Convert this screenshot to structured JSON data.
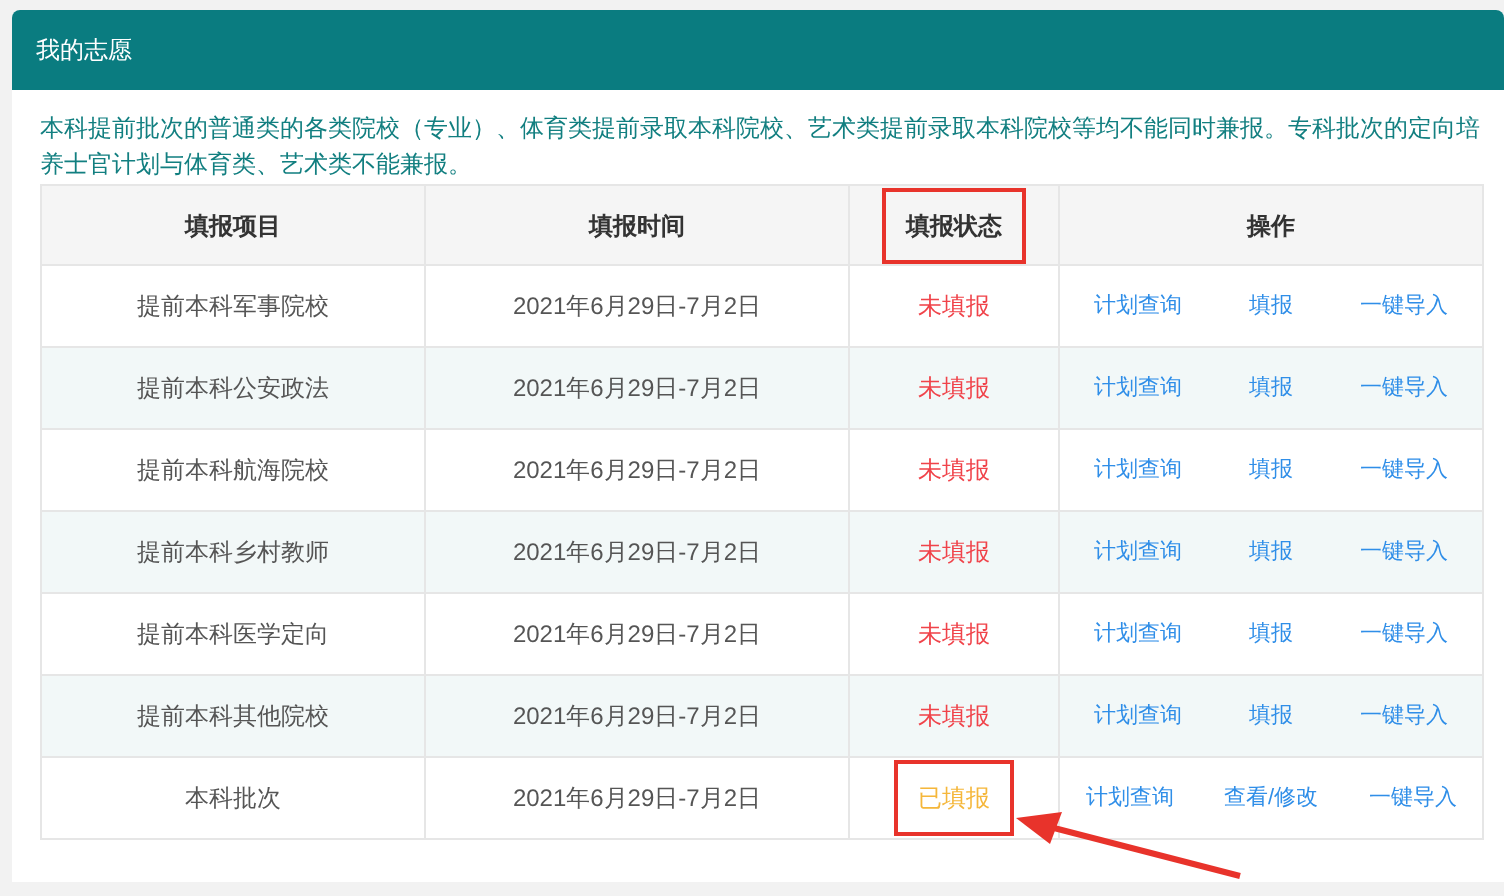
{
  "panel": {
    "title": "我的志愿"
  },
  "notice": "本科提前批次的普通类的各类院校（专业）、体育类提前录取本科院校、艺术类提前录取本科院校等均不能同时兼报。专科批次的定向培养士官计划与体育类、艺术类不能兼报。",
  "table": {
    "columns": [
      {
        "label": "填报项目",
        "highlighted": false
      },
      {
        "label": "填报时间",
        "highlighted": false
      },
      {
        "label": "填报状态",
        "highlighted": true
      },
      {
        "label": "操作",
        "highlighted": false
      }
    ],
    "rows": [
      {
        "item": "提前本科军事院校",
        "time": "2021年6月29日-7月2日",
        "status": "未填报",
        "filled": false,
        "highlighted": false,
        "actions": [
          "计划查询",
          "填报",
          "一键导入"
        ]
      },
      {
        "item": "提前本科公安政法",
        "time": "2021年6月29日-7月2日",
        "status": "未填报",
        "filled": false,
        "highlighted": false,
        "actions": [
          "计划查询",
          "填报",
          "一键导入"
        ]
      },
      {
        "item": "提前本科航海院校",
        "time": "2021年6月29日-7月2日",
        "status": "未填报",
        "filled": false,
        "highlighted": false,
        "actions": [
          "计划查询",
          "填报",
          "一键导入"
        ]
      },
      {
        "item": "提前本科乡村教师",
        "time": "2021年6月29日-7月2日",
        "status": "未填报",
        "filled": false,
        "highlighted": false,
        "actions": [
          "计划查询",
          "填报",
          "一键导入"
        ]
      },
      {
        "item": "提前本科医学定向",
        "time": "2021年6月29日-7月2日",
        "status": "未填报",
        "filled": false,
        "highlighted": false,
        "actions": [
          "计划查询",
          "填报",
          "一键导入"
        ]
      },
      {
        "item": "提前本科其他院校",
        "time": "2021年6月29日-7月2日",
        "status": "未填报",
        "filled": false,
        "highlighted": false,
        "actions": [
          "计划查询",
          "填报",
          "一键导入"
        ]
      },
      {
        "item": "本科批次",
        "time": "2021年6月29日-7月2日",
        "status": "已填报",
        "filled": true,
        "highlighted": true,
        "actions": [
          "计划查询",
          "查看/修改",
          "一键导入"
        ]
      }
    ]
  }
}
